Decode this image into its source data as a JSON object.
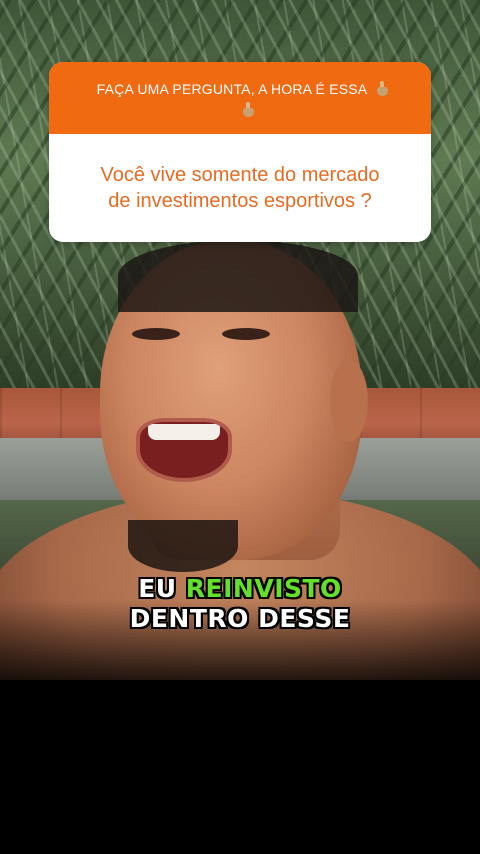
{
  "question_sticker": {
    "prompt": "FAÇA UMA PERGUNTA, A HORA É ESSA",
    "prompt_icons": [
      "pointing-down-icon",
      "pointing-down-icon"
    ],
    "question_line1": "Você vive somente do mercado",
    "question_line2": "de investimentos esportivos ?",
    "header_color": "#f06a12",
    "text_color": "#e56b23"
  },
  "caption": {
    "line1_word1": "EU",
    "line1_highlight": "REINVISTO",
    "line2": "DENTRO DESSE",
    "highlight_color": "#62e02b"
  }
}
